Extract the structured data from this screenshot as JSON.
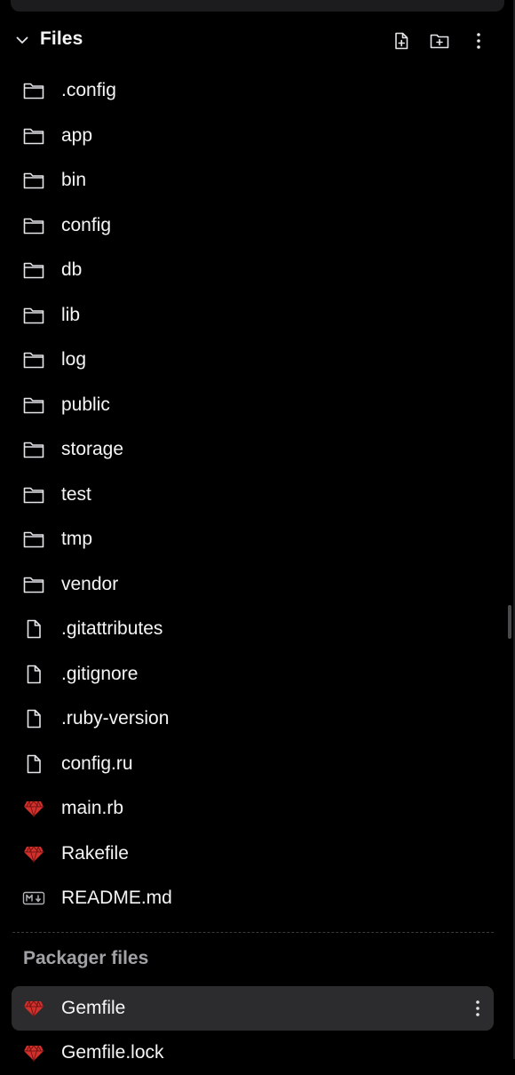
{
  "colors": {
    "background": "#000000",
    "text": "#f5f5f5",
    "muted_text": "#a1a1a6",
    "selected_row": "#2c2c2e",
    "ruby_red": "#d0312d"
  },
  "files": {
    "title": "Files",
    "collapse_icon": "chevron-down-icon",
    "actions": {
      "new_file_icon": "new-file-icon",
      "new_folder_icon": "new-folder-icon",
      "more_icon": "more-vertical-icon"
    },
    "items": [
      {
        "name": ".config",
        "icon": "folder-icon"
      },
      {
        "name": "app",
        "icon": "folder-icon"
      },
      {
        "name": "bin",
        "icon": "folder-icon"
      },
      {
        "name": "config",
        "icon": "folder-icon"
      },
      {
        "name": "db",
        "icon": "folder-icon"
      },
      {
        "name": "lib",
        "icon": "folder-icon"
      },
      {
        "name": "log",
        "icon": "folder-icon"
      },
      {
        "name": "public",
        "icon": "folder-icon"
      },
      {
        "name": "storage",
        "icon": "folder-icon"
      },
      {
        "name": "test",
        "icon": "folder-icon"
      },
      {
        "name": "tmp",
        "icon": "folder-icon"
      },
      {
        "name": "vendor",
        "icon": "folder-icon"
      },
      {
        "name": ".gitattributes",
        "icon": "file-icon"
      },
      {
        "name": ".gitignore",
        "icon": "file-icon"
      },
      {
        "name": ".ruby-version",
        "icon": "file-icon"
      },
      {
        "name": "config.ru",
        "icon": "file-icon"
      },
      {
        "name": "main.rb",
        "icon": "ruby-icon"
      },
      {
        "name": "Rakefile",
        "icon": "ruby-icon"
      },
      {
        "name": "README.md",
        "icon": "markdown-icon"
      }
    ]
  },
  "packager": {
    "title": "Packager files",
    "items": [
      {
        "name": "Gemfile",
        "icon": "ruby-icon",
        "selected": true
      },
      {
        "name": "Gemfile.lock",
        "icon": "ruby-icon",
        "selected": false
      }
    ]
  }
}
